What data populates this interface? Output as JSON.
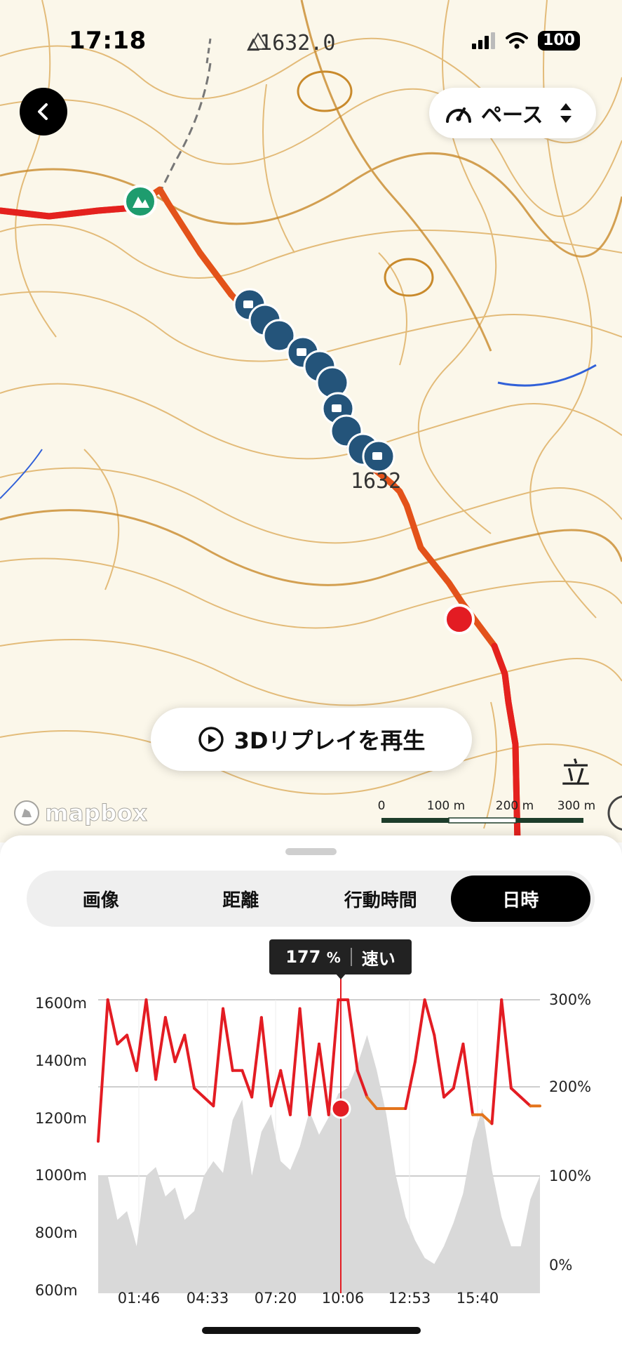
{
  "status_bar": {
    "time": "17:18",
    "battery": "100",
    "icons": [
      "cellular-signal-icon",
      "wifi-icon",
      "battery-icon"
    ]
  },
  "map": {
    "summit_label": "△1632.0",
    "elevation_label": "1632",
    "map_char": "立",
    "attribution": "mapbox",
    "scale_labels": [
      "0",
      "100 m",
      "200 m",
      "300 m"
    ],
    "pace_button_label": "ペース",
    "replay_button_label": "3Dリプレイを再生",
    "route_colors": {
      "start": "#e8321a",
      "mid": "#e36b14",
      "end": "#e51c24"
    },
    "accent_green": "#1e9c6e",
    "photo_pin_color": "#24547a"
  },
  "tabs": {
    "items": [
      "画像",
      "距離",
      "行動時間",
      "日時"
    ],
    "active": "日時"
  },
  "tooltip": {
    "value": "177",
    "unit": "%",
    "label": "速い"
  },
  "chart_data": {
    "type": "area",
    "title": "",
    "x_ticks": [
      "01:46",
      "04:33",
      "07:20",
      "10:06",
      "12:53",
      "15:40"
    ],
    "y_left_ticks": [
      "1600m",
      "1400m",
      "1200m",
      "1000m",
      "800m",
      "600m"
    ],
    "y_right_ticks": [
      "300%",
      "200%",
      "100%",
      "0%"
    ],
    "ylim_left": [
      600,
      1600
    ],
    "ylim_right": [
      0,
      300
    ],
    "cursor_time": "10:06",
    "cursor_pace_percent": 177,
    "series": [
      {
        "name": "",
        "unit": "m",
        "color": "#d9d9d9",
        "values": [
          1000,
          1000,
          850,
          880,
          760,
          1000,
          1030,
          930,
          960,
          850,
          880,
          1000,
          1050,
          1010,
          1190,
          1260,
          1000,
          1150,
          1210,
          1050,
          1020,
          1100,
          1220,
          1140,
          1200,
          1280,
          1300,
          1380,
          1480,
          1360,
          1210,
          1000,
          860,
          780,
          720,
          700,
          760,
          840,
          940,
          1120,
          1230,
          1020,
          860,
          760,
          760,
          920,
          1000
        ]
      },
      {
        "name": "",
        "unit": "%",
        "color": "#e31c23",
        "values": [
          140,
          300,
          250,
          260,
          220,
          300,
          210,
          280,
          230,
          260,
          200,
          190,
          180,
          290,
          220,
          220,
          190,
          280,
          180,
          220,
          170,
          290,
          170,
          250,
          170,
          300,
          300,
          220,
          190,
          177,
          177,
          177,
          177,
          230,
          300,
          260,
          190,
          200,
          250,
          170,
          170,
          160,
          300,
          200,
          190,
          180,
          180
        ]
      }
    ]
  }
}
